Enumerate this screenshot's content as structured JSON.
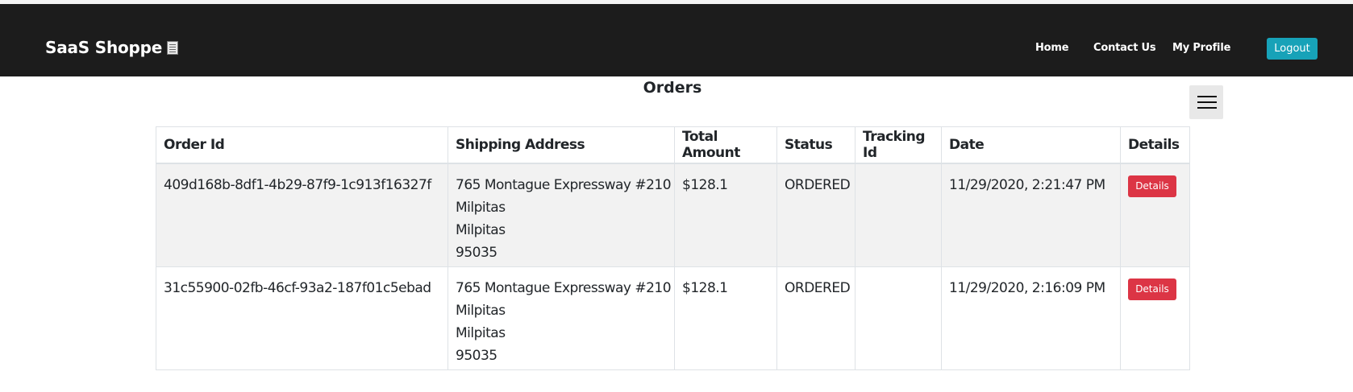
{
  "navbar": {
    "brand": "SaaS Shoppe",
    "brand_icon": "document-icon",
    "links": [
      "Home",
      "Contact Us",
      "My Profile"
    ],
    "logout_label": "Logout",
    "colors": {
      "background": "#1c1c1c",
      "logout_button": "#17a2b8"
    }
  },
  "page": {
    "title": "Orders",
    "menu_icon": "hamburger-icon"
  },
  "table": {
    "columns": [
      "Order Id",
      "Shipping Address",
      "Total Amount",
      "Status",
      "Tracking Id",
      "Date",
      "Details"
    ],
    "rows": [
      {
        "order_id": "409d168b-8df1-4b29-87f9-1c913f16327f",
        "address": [
          "765 Montague Expressway #210",
          "Milpitas",
          "Milpitas",
          "95035"
        ],
        "total": "$128.1",
        "status": "ORDERED",
        "tracking_id": "",
        "date": "11/29/2020, 2:21:47 PM",
        "details_label": "Details"
      },
      {
        "order_id": "31c55900-02fb-46cf-93a2-187f01c5ebad",
        "address": [
          "765 Montague Expressway #210",
          "Milpitas",
          "Milpitas",
          "95035"
        ],
        "total": "$128.1",
        "status": "ORDERED",
        "tracking_id": "",
        "date": "11/29/2020, 2:16:09 PM",
        "details_label": "Details"
      }
    ],
    "details_button_color": "#dc3545"
  }
}
